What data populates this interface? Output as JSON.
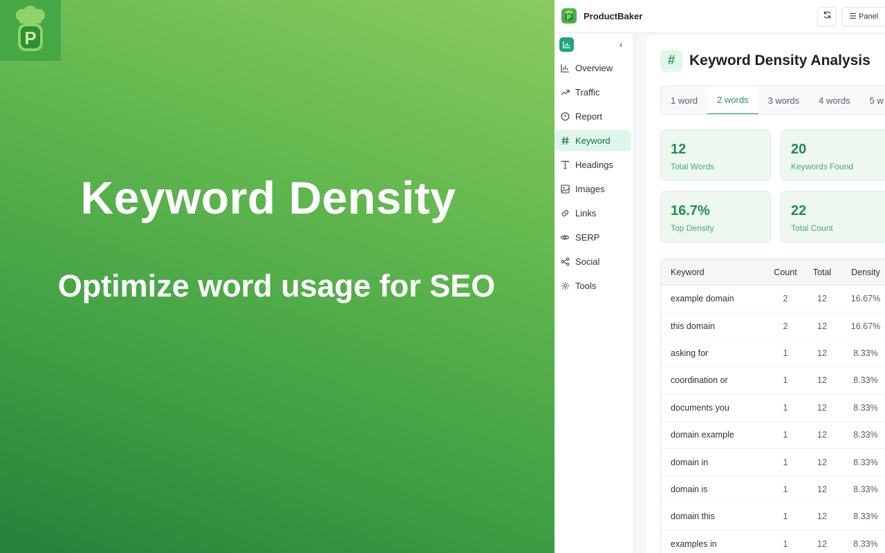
{
  "promo": {
    "title": "Keyword Density",
    "subtitle": "Optimize word usage for SEO"
  },
  "header": {
    "brand": "ProductBaker",
    "panel_label": "Panel"
  },
  "sidebar": {
    "items": [
      {
        "label": "Overview",
        "icon": "bar-chart-icon",
        "active": false
      },
      {
        "label": "Traffic",
        "icon": "trend-up-icon",
        "active": false
      },
      {
        "label": "Report",
        "icon": "alert-circle-icon",
        "active": false
      },
      {
        "label": "Keyword",
        "icon": "hash-icon",
        "active": true
      },
      {
        "label": "Headings",
        "icon": "text-type-icon",
        "active": false
      },
      {
        "label": "Images",
        "icon": "image-icon",
        "active": false
      },
      {
        "label": "Links",
        "icon": "link-icon",
        "active": false
      },
      {
        "label": "SERP",
        "icon": "eye-icon",
        "active": false
      },
      {
        "label": "Social",
        "icon": "share-icon",
        "active": false
      },
      {
        "label": "Tools",
        "icon": "gear-icon",
        "active": false
      }
    ]
  },
  "main": {
    "title": "Keyword Density Analysis",
    "tabs": [
      "1 word",
      "2 words",
      "3 words",
      "4 words",
      "5 w"
    ],
    "active_tab": 1,
    "stats": [
      {
        "value": "12",
        "label": "Total Words"
      },
      {
        "value": "20",
        "label": "Keywords Found"
      },
      {
        "value": "16.7%",
        "label": "Top Density"
      },
      {
        "value": "22",
        "label": "Total Count"
      }
    ],
    "table": {
      "headers": [
        "Keyword",
        "Count",
        "Total",
        "Density"
      ],
      "rows": [
        [
          "example domain",
          "2",
          "12",
          "16.67%"
        ],
        [
          "this domain",
          "2",
          "12",
          "16.67%"
        ],
        [
          "asking for",
          "1",
          "12",
          "8.33%"
        ],
        [
          "coordination or",
          "1",
          "12",
          "8.33%"
        ],
        [
          "documents you",
          "1",
          "12",
          "8.33%"
        ],
        [
          "domain example",
          "1",
          "12",
          "8.33%"
        ],
        [
          "domain in",
          "1",
          "12",
          "8.33%"
        ],
        [
          "domain is",
          "1",
          "12",
          "8.33%"
        ],
        [
          "domain this",
          "1",
          "12",
          "8.33%"
        ],
        [
          "examples in",
          "1",
          "12",
          "8.33%"
        ]
      ]
    }
  },
  "colors": {
    "accent": "#22a062",
    "active_nav_bg": "#dff7ea",
    "stat_bg": "#eef7f0"
  }
}
